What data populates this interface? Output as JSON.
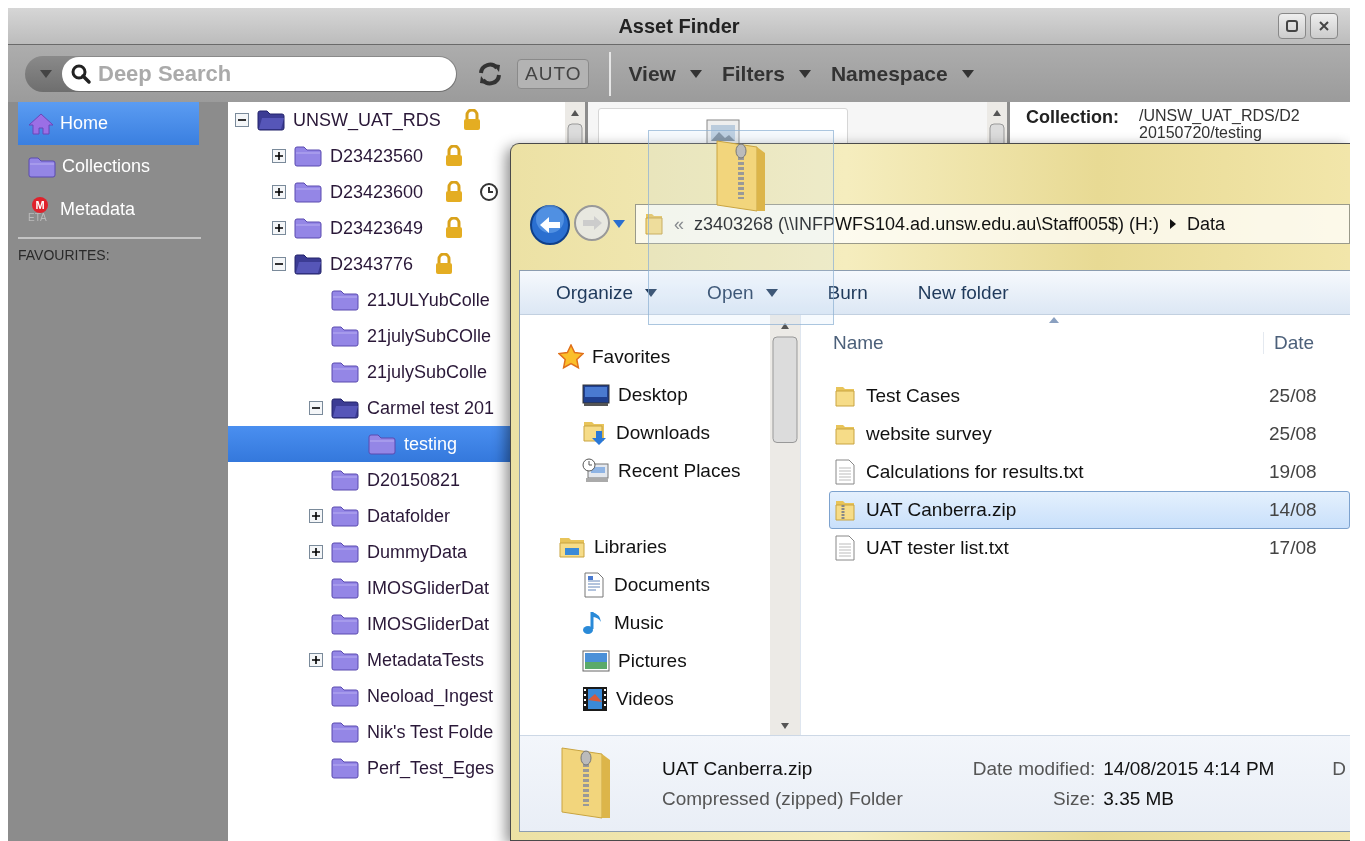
{
  "window": {
    "title": "Asset Finder"
  },
  "toolbar": {
    "search": {
      "placeholder": "Deep Search"
    },
    "auto_button": "AUTO",
    "menus": [
      "View",
      "Filters",
      "Namespace"
    ]
  },
  "sidebar": {
    "items": [
      {
        "label": "Home",
        "selected": true
      },
      {
        "label": "Collections",
        "selected": false
      },
      {
        "label": "Metadata",
        "icon_text": [
          "M",
          "ETA"
        ],
        "selected": false
      }
    ],
    "favourites_label": "FAVOURITES:"
  },
  "tree": [
    {
      "label": "UNSW_UAT_RDS",
      "kind": "branch",
      "expanded": true,
      "locked": true,
      "clock": false,
      "selected": false,
      "children": [
        {
          "label": "D23423560",
          "kind": "branch",
          "expanded": false,
          "locked": true,
          "clock": false,
          "selected": false
        },
        {
          "label": "D23423600",
          "kind": "branch",
          "expanded": false,
          "locked": true,
          "clock": true,
          "selected": false
        },
        {
          "label": "D23423649",
          "kind": "branch",
          "expanded": false,
          "locked": true,
          "clock": false,
          "selected": false
        },
        {
          "label": "D2343776",
          "kind": "branch",
          "expanded": true,
          "locked": true,
          "clock": false,
          "selected": false,
          "children": [
            {
              "label": "21JULYubColle",
              "kind": "leaf",
              "locked": false,
              "clock": false,
              "selected": false
            },
            {
              "label": "21julySubCOlle",
              "kind": "leaf",
              "locked": false,
              "clock": false,
              "selected": false
            },
            {
              "label": "21julySubColle",
              "kind": "leaf",
              "locked": false,
              "clock": false,
              "selected": false
            },
            {
              "label": "Carmel test 201",
              "kind": "branch",
              "expanded": true,
              "locked": false,
              "clock": false,
              "selected": false,
              "children": [
                {
                  "label": "testing",
                  "locked": false,
                  "clock": false,
                  "selected": true
                }
              ]
            },
            {
              "label": "D20150821",
              "kind": "leaf",
              "locked": false,
              "clock": false,
              "selected": false
            },
            {
              "label": "Datafolder",
              "kind": "branch",
              "expanded": false,
              "locked": false,
              "clock": false,
              "selected": false
            },
            {
              "label": "DummyData",
              "kind": "branch",
              "expanded": false,
              "locked": false,
              "clock": false,
              "selected": false
            },
            {
              "label": "IMOSGliderDat",
              "kind": "leaf",
              "locked": false,
              "clock": false,
              "selected": false
            },
            {
              "label": "IMOSGliderDat",
              "kind": "leaf",
              "locked": false,
              "clock": false,
              "selected": false
            },
            {
              "label": "MetadataTests",
              "kind": "branch",
              "expanded": false,
              "locked": false,
              "clock": false,
              "selected": false
            },
            {
              "label": "Neoload_Ingest",
              "kind": "leaf",
              "locked": false,
              "clock": false,
              "selected": false
            },
            {
              "label": "Nik's Test Folde",
              "kind": "leaf",
              "locked": false,
              "clock": false,
              "selected": false
            },
            {
              "label": "Perf_Test_Eges",
              "kind": "leaf",
              "locked": false,
              "clock": false,
              "selected": false
            }
          ]
        }
      ]
    }
  ],
  "details": {
    "label": "Collection:",
    "path_lines": [
      "/UNSW_UAT_RDS/D2",
      "20150720/testing"
    ]
  },
  "explorer": {
    "address": {
      "prefix": "«",
      "path": "z3403268 (\\\\INFPWFS104.ad.unsw.edu.au\\Staff005$) (H:)",
      "next": "Data"
    },
    "commands": [
      {
        "label": "Organize",
        "dropdown": true
      },
      {
        "label": "Open",
        "dropdown": true
      },
      {
        "label": "Burn",
        "dropdown": false
      },
      {
        "label": "New folder",
        "dropdown": false
      }
    ],
    "nav": [
      {
        "label": "Favorites",
        "kind": "group"
      },
      {
        "label": "Desktop",
        "kind": "item"
      },
      {
        "label": "Downloads",
        "kind": "item"
      },
      {
        "label": "Recent Places",
        "kind": "item"
      },
      {
        "label": "Libraries",
        "kind": "group"
      },
      {
        "label": "Documents",
        "kind": "item"
      },
      {
        "label": "Music",
        "kind": "item"
      },
      {
        "label": "Pictures",
        "kind": "item"
      },
      {
        "label": "Videos",
        "kind": "item"
      }
    ],
    "columns": [
      "Name",
      "Date"
    ],
    "files": [
      {
        "name": "Test Cases",
        "kind": "folder",
        "date": "25/08",
        "selected": false
      },
      {
        "name": "website survey",
        "kind": "folder",
        "date": "25/08",
        "selected": false
      },
      {
        "name": "Calculations for results.txt",
        "kind": "text",
        "date": "19/08",
        "selected": false
      },
      {
        "name": "UAT Canberra.zip",
        "kind": "zip",
        "date": "14/08",
        "selected": true
      },
      {
        "name": "UAT tester list.txt",
        "kind": "text",
        "date": "17/08",
        "selected": false
      }
    ],
    "details_pane": {
      "name": "UAT Canberra.zip",
      "type": "Compressed (zipped) Folder",
      "fields": [
        {
          "label": "Date modified:",
          "value": "14/08/2015 4:14 PM"
        },
        {
          "label": "Size:",
          "value": "3.35 MB"
        }
      ],
      "column_3": "D"
    }
  }
}
